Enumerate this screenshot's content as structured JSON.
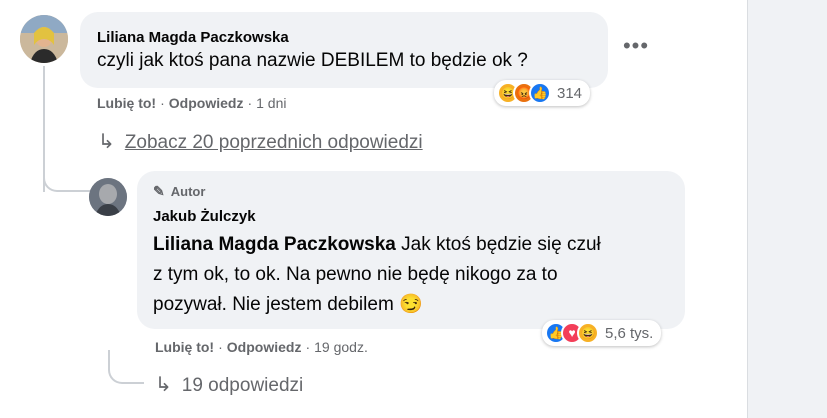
{
  "comment1": {
    "author": "Liliana Magda Paczkowska",
    "text": "czyli jak ktoś pana nazwie DEBILEM to będzie ok ?",
    "like_label": "Lubię to!",
    "reply_label": "Odpowiedz",
    "time": "1 dni",
    "reaction_count": "314",
    "reactions": [
      "haha-icon",
      "angry-icon",
      "like-icon"
    ]
  },
  "view_previous": {
    "arrow": "↳",
    "label": "Zobacz 20 poprzednich odpowiedzi"
  },
  "comment2": {
    "badge": "Autor",
    "author": "Jakub Żulczyk",
    "mention": "Liliana Magda Paczkowska",
    "text_line1_rest": " Jak ktoś będzie się czuł",
    "text_line2": "z tym ok, to ok. Na pewno nie będę nikogo za to",
    "text_line3": "pozywał. Nie jestem debilem",
    "emoji": "😏",
    "like_label": "Lubię to!",
    "reply_label": "Odpowiedz",
    "time": "19 godz.",
    "reaction_count": "5,6 tys.",
    "reactions": [
      "like-icon",
      "love-icon",
      "haha-icon"
    ]
  },
  "replies": {
    "arrow": "↳",
    "label": "19 odpowiedzi"
  },
  "colors": {
    "bubble": "#f0f2f5",
    "secondary_text": "#65676b",
    "like_blue": "#1877f2",
    "love_red": "#f33e58",
    "haha_yellow": "#f7b125",
    "angry_orange": "#e9710f"
  }
}
